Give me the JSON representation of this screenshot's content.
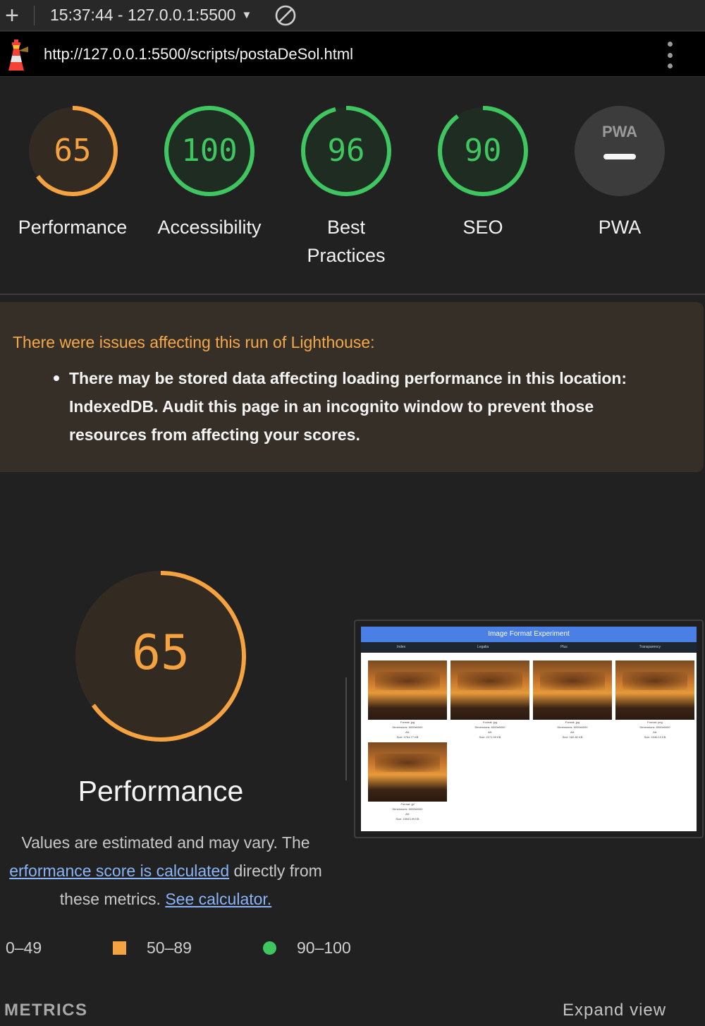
{
  "toolbar": {
    "session_label": "15:37:44 - 127.0.0.1:5500"
  },
  "urlbar": {
    "url": "http://127.0.0.1:5500/scripts/postaDeSol.html"
  },
  "scores": [
    {
      "label": "Performance",
      "value": "65",
      "fraction": 0.65,
      "color": "#f5a340"
    },
    {
      "label": "Accessibility",
      "value": "100",
      "fraction": 1.0,
      "color": "#3fc661"
    },
    {
      "label": "Best Practices",
      "value": "96",
      "fraction": 0.96,
      "color": "#3fc661"
    },
    {
      "label": "SEO",
      "value": "90",
      "fraction": 0.9,
      "color": "#3fc661"
    },
    {
      "label": "PWA",
      "badge": "PWA"
    }
  ],
  "warning": {
    "title": "There were issues affecting this run of Lighthouse:",
    "items": [
      "There may be stored data affecting loading performance in this location: IndexedDB. Audit this page in an incognito window to prevent those resources from affecting your scores."
    ]
  },
  "performance": {
    "score": "65",
    "fraction": 0.65,
    "title": "Performance",
    "desc_1": "Values are estimated and may vary. The",
    "desc_link_1": "erformance score is calculated",
    "desc_2": "directly from these metrics.",
    "desc_link_2": "See calculator."
  },
  "thumbnail": {
    "title": "Image Format Experiment",
    "nav": [
      "Index",
      "Legalia",
      "Plus",
      "Transparency"
    ],
    "cards": [
      {
        "caption": [
          "Format: jpg",
          "Dimensions: 6000x6000",
          "Alt:",
          "Size: 4764.77 KB"
        ]
      },
      {
        "caption": [
          "Format: jpg",
          "Dimensions: 6000x6000",
          "Alt:",
          "Size: 2171.99 KB"
        ]
      },
      {
        "caption": [
          "Format: jpg",
          "Dimensions: 6000x6000",
          "Alt:",
          "Size: 182.80 KB"
        ]
      },
      {
        "caption": [
          "Format: png",
          "Dimensions: 6000x6000",
          "Alt:",
          "Size: 4346.10 KB"
        ]
      },
      {
        "caption": [
          "Format: gif",
          "Dimensions: 6000x6000",
          "Alt:",
          "Size: 15543.99 KB"
        ]
      }
    ]
  },
  "legend": {
    "low": "0–49",
    "mid": "50–89",
    "high": "90–100"
  },
  "metrics": {
    "heading": "METRICS",
    "expand": "Expand view"
  },
  "colors": {
    "orange": "#f5a340",
    "green": "#3fc661",
    "red": "#ff4e42",
    "link": "#8ab4f8"
  }
}
